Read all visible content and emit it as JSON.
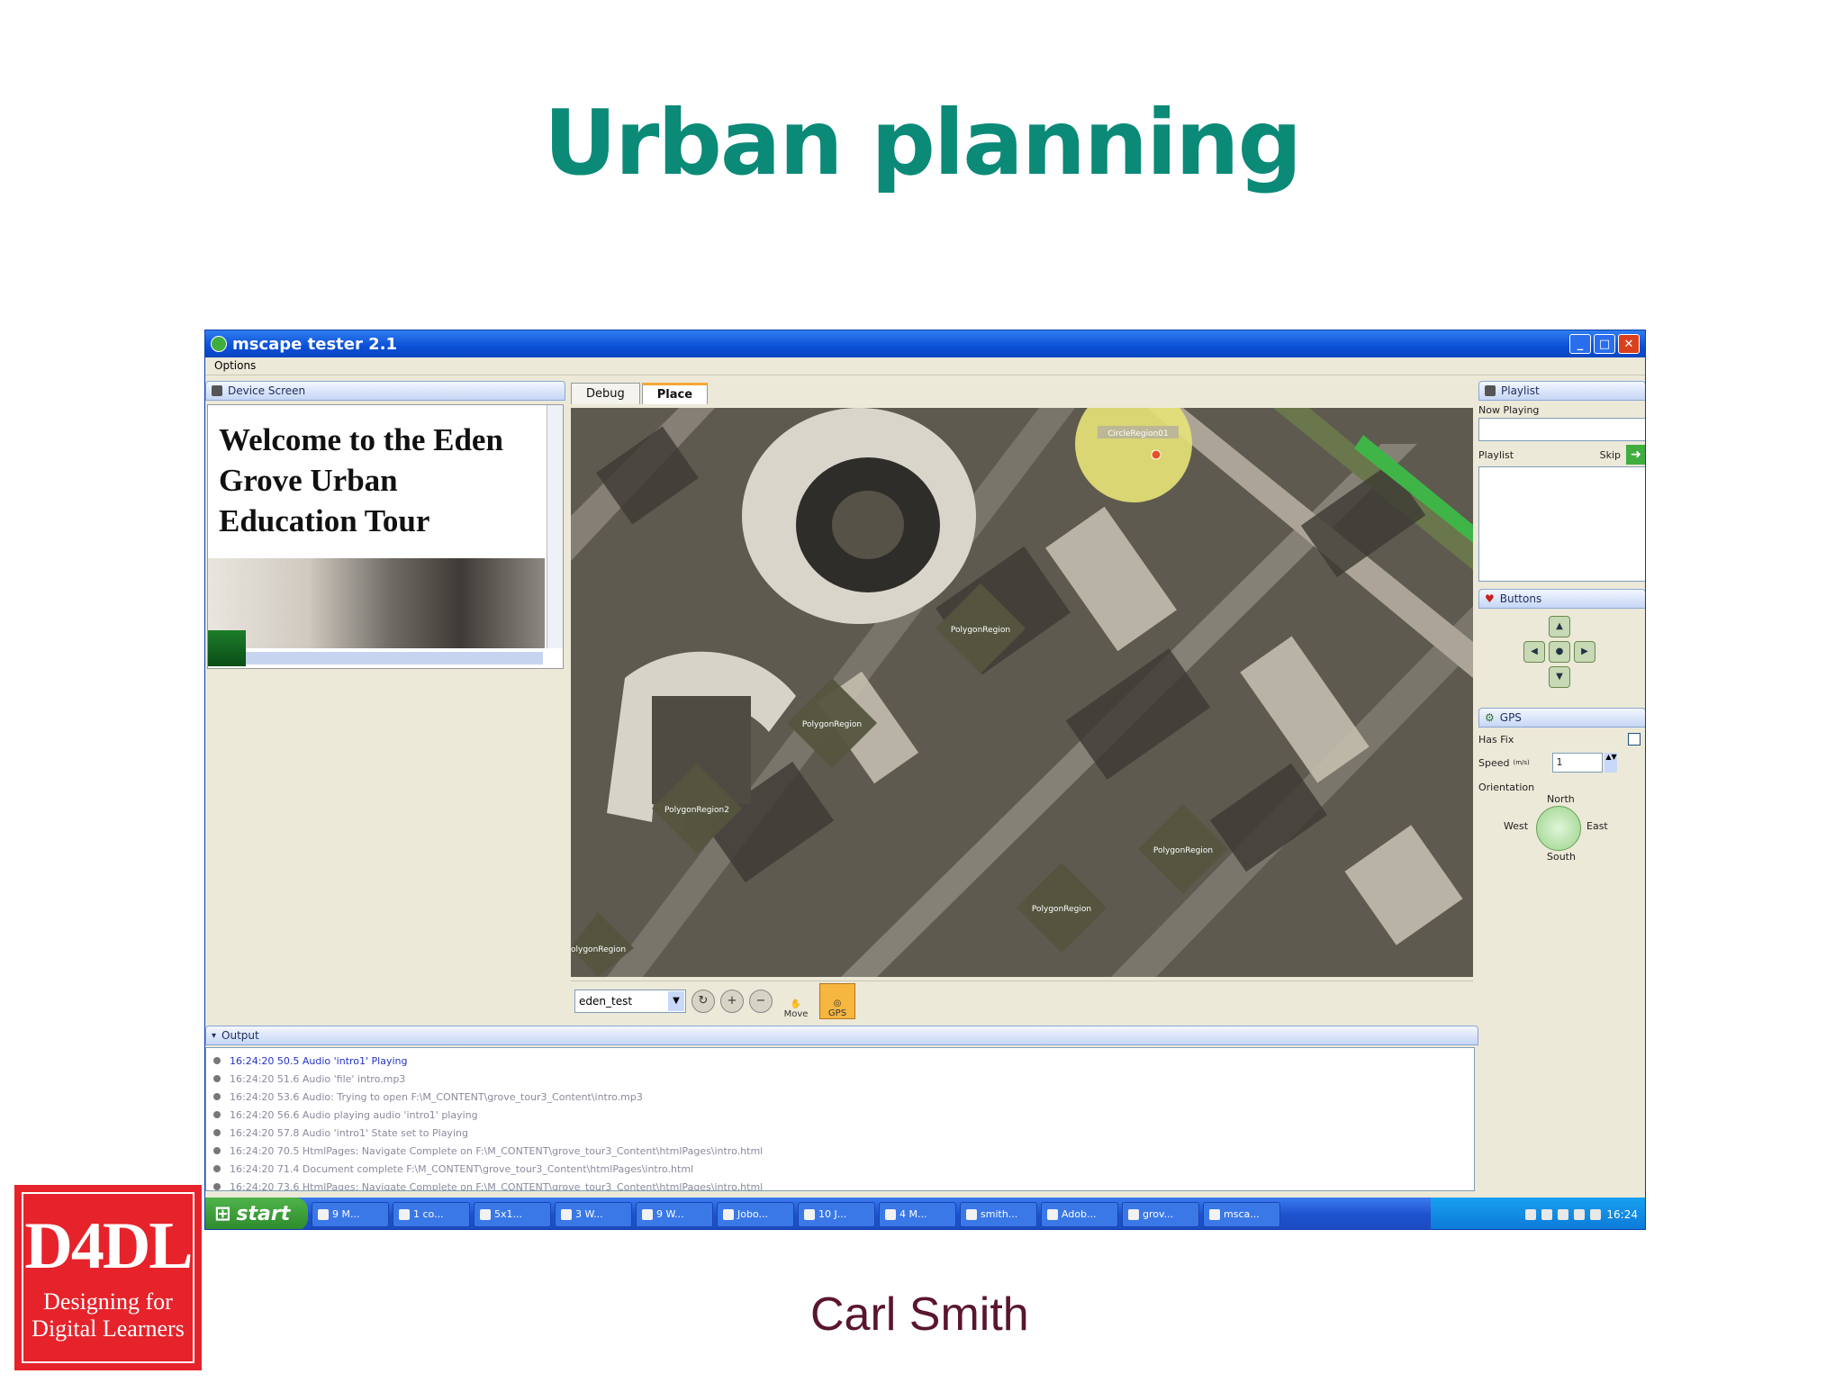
{
  "slide": {
    "title": "Urban planning",
    "author": "Carl Smith",
    "logo": {
      "main": "D4DL",
      "sub_line1": "Designing for",
      "sub_line2": "Digital Learners"
    }
  },
  "app": {
    "window_title": "mscape tester 2.1",
    "menu": [
      "Options"
    ],
    "device_panel": {
      "header": "Device Screen",
      "welcome_text": "Welcome to the Eden Grove Urban Education Tour"
    },
    "tabs": [
      {
        "label": "Debug"
      },
      {
        "label": "Place"
      }
    ],
    "map": {
      "regions": [
        {
          "label": "CircleRegion01"
        },
        {
          "label": "PolygonRegion"
        },
        {
          "label": "PolygonRegion"
        },
        {
          "label": "PolygonRegion2"
        },
        {
          "label": "PolygonRegion"
        },
        {
          "label": "PolygonRegion"
        },
        {
          "label": "PolygonRegion"
        }
      ],
      "map_select": "eden_test",
      "move_label": "Move",
      "gps_label": "GPS"
    },
    "playlist_panel": {
      "header": "Playlist",
      "now_playing_label": "Now Playing",
      "playlist_label": "Playlist",
      "skip_label": "Skip"
    },
    "buttons_panel": {
      "header": "Buttons"
    },
    "gps_panel": {
      "header": "GPS",
      "has_fix_label": "Has Fix",
      "speed_label": "Speed",
      "speed_unit": "(m/s)",
      "speed_value": "1",
      "orientation_label": "Orientation",
      "north": "North",
      "west": "West",
      "east": "East",
      "south": "South"
    },
    "output_panel": {
      "header": "Output",
      "lines": [
        "16:24:20 50.5 Audio 'intro1' Playing",
        "16:24:20 51.6 Audio 'file' intro.mp3",
        "16:24:20 53.6 Audio: Trying to open F:\\M_CONTENT\\grove_tour3_Content\\intro.mp3",
        "16:24:20 56.6 Audio playing audio 'intro1' playing",
        "16:24:20 57.8 Audio 'intro1' State set to Playing",
        "16:24:20 70.5 HtmlPages: Navigate Complete on F:\\M_CONTENT\\grove_tour3_Content\\htmlPages\\intro.html",
        "16:24:20 71.4 Document complete F:\\M_CONTENT\\grove_tour3_Content\\htmlPages\\intro.html",
        "16:24:20 73.6 HtmlPages: Navigate Complete on F:\\M_CONTENT\\grove_tour3_Content\\htmlPages\\intro.html"
      ]
    },
    "taskbar": {
      "start_label": "start",
      "items": [
        "9 M...",
        "1 co...",
        "5x1...",
        "3 W...",
        "9 W...",
        "Jobo...",
        "10 J...",
        "4 M...",
        "smith...",
        "Adob...",
        "grov...",
        "msca..."
      ],
      "clock": "16:24"
    }
  }
}
